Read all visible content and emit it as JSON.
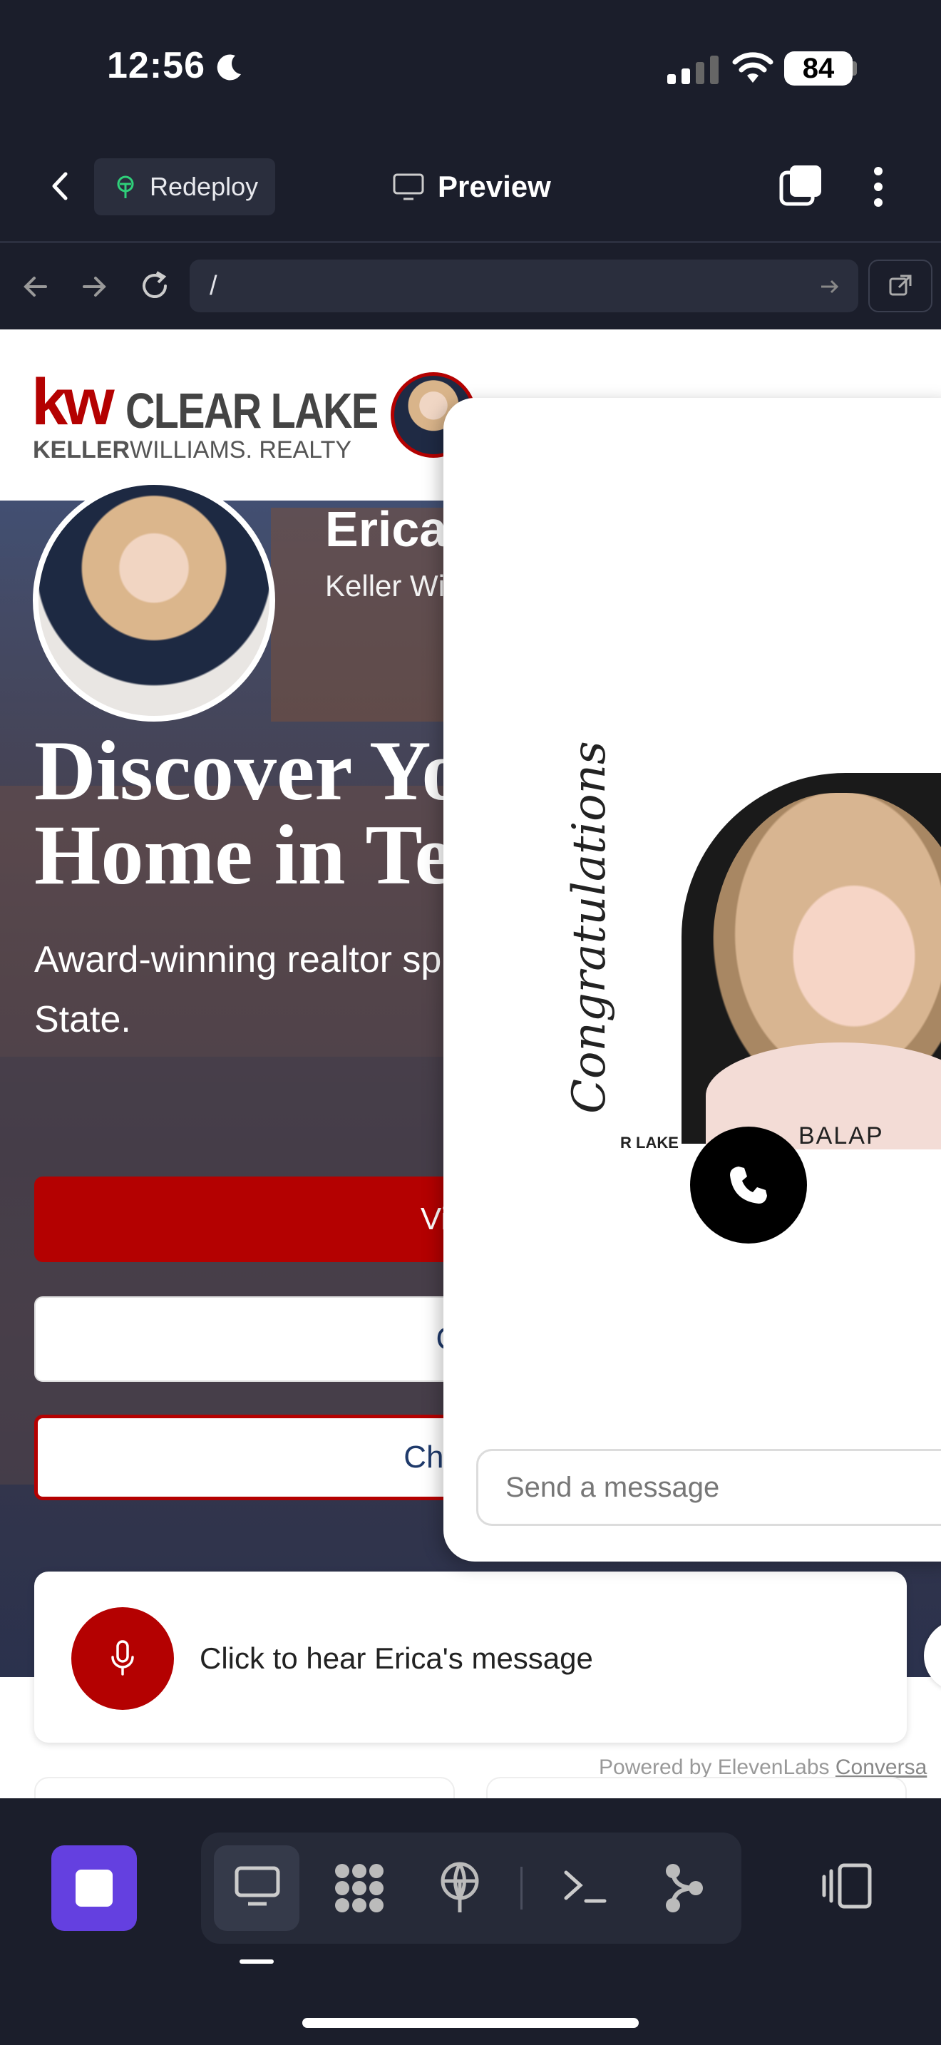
{
  "status_bar": {
    "time": "12:56",
    "battery": "84"
  },
  "app_header": {
    "redeploy_label": "Redeploy",
    "preview_label": "Preview"
  },
  "browser": {
    "url": "/"
  },
  "site": {
    "logo_kw": "kw",
    "logo_office": "CLEAR LAKE",
    "logo_keller": "KELLER",
    "logo_williams": "WILLIAMS. REALTY",
    "agent_name": "Erica",
    "agent_company": "Keller Wi",
    "hero_title_line1": "Discover Yo",
    "hero_title_line2": "Home in Te",
    "hero_subtitle": "Award-winning realtor sp and commercial propert State.",
    "btn_view": "View P",
    "btn_contact": "Cont",
    "btn_chat": "Chat with",
    "voice_label": "Click to hear Erica's message",
    "powered_by": "Powered by ElevenLabs",
    "powered_link": "Conversa"
  },
  "widget": {
    "avatar_script": "Congratulations",
    "avatar_text_right": "BALAP",
    "avatar_text_left": "R LAKE",
    "input_placeholder": "Send a message"
  },
  "colors": {
    "brand_red": "#b40101",
    "accent_purple": "#6440e0",
    "dark_bg": "#1b1e2b"
  }
}
